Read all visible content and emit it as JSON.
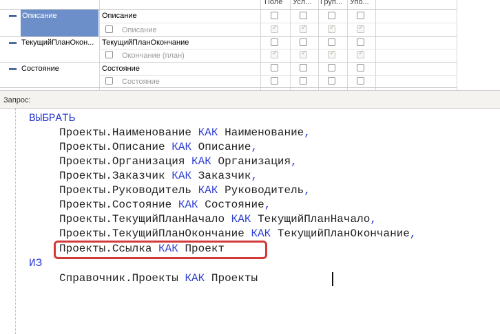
{
  "grid": {
    "columns": [
      "Поле",
      "Усл...",
      "Груп...",
      "Упо..."
    ],
    "rows": [
      {
        "name": "Описание",
        "field": "Описание",
        "subfield": "Описание"
      },
      {
        "name": "ТекущийПланОкон...",
        "field": "ТекущийПланОкончание",
        "subfield": "Окончание (план)"
      },
      {
        "name": "Состояние",
        "field": "Состояние",
        "subfield": "Состояние"
      }
    ]
  },
  "query_label": "Запрос:",
  "query": {
    "select_kw": "ВЫБРАТЬ",
    "lines": [
      {
        "src": "Проекты.Наименование",
        "kw": "КАК",
        "alias": "Наименование",
        "comma": ","
      },
      {
        "src": "Проекты.Описание",
        "kw": "КАК",
        "alias": "Описание",
        "comma": ","
      },
      {
        "src": "Проекты.Организация",
        "kw": "КАК",
        "alias": "Организация",
        "comma": ","
      },
      {
        "src": "Проекты.Заказчик",
        "kw": "КАК",
        "alias": "Заказчик",
        "comma": ","
      },
      {
        "src": "Проекты.Руководитель",
        "kw": "КАК",
        "alias": "Руководитель",
        "comma": ","
      },
      {
        "src": "Проекты.Состояние",
        "kw": "КАК",
        "alias": "Состояние",
        "comma": ","
      },
      {
        "src": "Проекты.ТекущийПланНачало",
        "kw": "КАК",
        "alias": "ТекущийПланНачало",
        "comma": ","
      },
      {
        "src": "Проекты.ТекущийПланОкончание",
        "kw": "КАК",
        "alias": "ТекущийПланОкончание",
        "comma": ","
      },
      {
        "src": "Проекты.Ссылка",
        "kw": "КАК",
        "alias": "Проект",
        "comma": ""
      }
    ],
    "from_kw": "ИЗ",
    "from_line": {
      "src": "Справочник.Проекты",
      "kw": "КАК",
      "alias": "Проекты"
    }
  },
  "colors": {
    "keyword": "#2d3dcf",
    "highlight": "#d23a3a",
    "selection": "#6d8fc9"
  }
}
